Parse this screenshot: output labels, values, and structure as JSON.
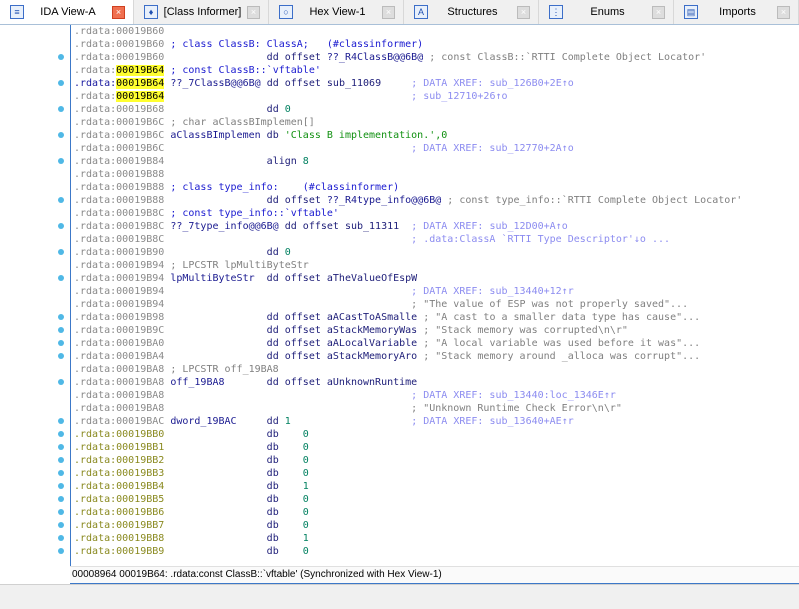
{
  "tabs": [
    {
      "label": "IDA View-A",
      "icon": "ida-view-icon",
      "active": true
    },
    {
      "label": "[Class Informer]",
      "icon": "class-informer-icon",
      "active": false
    },
    {
      "label": "Hex View-1",
      "icon": "hex-view-icon",
      "active": false
    },
    {
      "label": "Structures",
      "icon": "structures-icon",
      "active": false
    },
    {
      "label": "Enums",
      "icon": "enums-icon",
      "active": false
    },
    {
      "label": "Imports",
      "icon": "imports-icon",
      "active": false
    }
  ],
  "listing": [
    [
      [
        "a",
        ".rdata:00019B60"
      ]
    ],
    [
      [
        "a",
        ".rdata:00019B60"
      ],
      [
        "bl",
        " ; class ClassB: ClassA;   (#classinformer)"
      ]
    ],
    [
      [
        "a",
        ".rdata:00019B60"
      ],
      [
        "p",
        "                 "
      ],
      [
        "m",
        "dd offset "
      ],
      [
        "l",
        "??_R4ClassB@@6B@"
      ],
      [
        "cm",
        " ; const ClassB::`RTTI Complete Object Locator'"
      ]
    ],
    [
      [
        "a",
        ".rdata:"
      ],
      [
        "h",
        "00019B64"
      ],
      [
        "bl",
        " ; const ClassB::`vftable'"
      ]
    ],
    [
      [
        "ab",
        ".rdata:"
      ],
      [
        "h",
        "00019B64"
      ],
      [
        "l",
        " ??_7ClassB@@6B@ "
      ],
      [
        "m",
        "dd offset "
      ],
      [
        "o",
        "sub_11069"
      ],
      [
        "p",
        "     "
      ],
      [
        "x",
        "; DATA XREF: sub_126B0+2E↑o"
      ]
    ],
    [
      [
        "a",
        ".rdata:"
      ],
      [
        "h",
        "00019B64"
      ],
      [
        "p",
        "                                         "
      ],
      [
        "x",
        "; sub_12710+26↑o"
      ]
    ],
    [
      [
        "a",
        ".rdata:00019B68"
      ],
      [
        "p",
        "                 "
      ],
      [
        "m",
        "dd "
      ],
      [
        "n",
        "0"
      ]
    ],
    [
      [
        "a",
        ".rdata:00019B6C"
      ],
      [
        "cm",
        " ; char aClassBImplemen[]"
      ]
    ],
    [
      [
        "a",
        ".rdata:00019B6C"
      ],
      [
        "l",
        " aClassBImplemen "
      ],
      [
        "m",
        "db "
      ],
      [
        "s",
        "'Class B implementation.',0"
      ]
    ],
    [
      [
        "a",
        ".rdata:00019B6C"
      ],
      [
        "p",
        "                                         "
      ],
      [
        "x",
        "; DATA XREF: sub_12770+2A↑o"
      ]
    ],
    [
      [
        "a",
        ".rdata:00019B84"
      ],
      [
        "p",
        "                 "
      ],
      [
        "m",
        "align "
      ],
      [
        "n",
        "8"
      ]
    ],
    [
      [
        "a",
        ".rdata:00019B88"
      ]
    ],
    [
      [
        "a",
        ".rdata:00019B88"
      ],
      [
        "bl",
        " ; class type_info:    (#classinformer)"
      ]
    ],
    [
      [
        "a",
        ".rdata:00019B88"
      ],
      [
        "p",
        "                 "
      ],
      [
        "m",
        "dd offset "
      ],
      [
        "l",
        "??_R4type_info@@6B@"
      ],
      [
        "cm",
        " ; const type_info::`RTTI Complete Object Locator'"
      ]
    ],
    [
      [
        "a",
        ".rdata:00019B8C"
      ],
      [
        "bl",
        " ; const type_info::`vftable'"
      ]
    ],
    [
      [
        "a",
        ".rdata:00019B8C"
      ],
      [
        "l",
        " ??_7type_info@@6B@ "
      ],
      [
        "m",
        "dd offset "
      ],
      [
        "o",
        "sub_11311"
      ],
      [
        "p",
        "  "
      ],
      [
        "x",
        "; DATA XREF: sub_12D00+A↑o"
      ]
    ],
    [
      [
        "a",
        ".rdata:00019B8C"
      ],
      [
        "p",
        "                                         "
      ],
      [
        "x",
        "; .data:ClassA `RTTI Type Descriptor'↓o ..."
      ]
    ],
    [
      [
        "a",
        ".rdata:00019B90"
      ],
      [
        "p",
        "                 "
      ],
      [
        "m",
        "dd "
      ],
      [
        "n",
        "0"
      ]
    ],
    [
      [
        "a",
        ".rdata:00019B94"
      ],
      [
        "cm",
        " ; LPCSTR lpMultiByteStr"
      ]
    ],
    [
      [
        "a",
        ".rdata:00019B94"
      ],
      [
        "l",
        " lpMultiByteStr  "
      ],
      [
        "m",
        "dd offset "
      ],
      [
        "o",
        "aTheValueOfEspW"
      ]
    ],
    [
      [
        "a",
        ".rdata:00019B94"
      ],
      [
        "p",
        "                                         "
      ],
      [
        "x",
        "; DATA XREF: sub_13440+12↑r"
      ]
    ],
    [
      [
        "a",
        ".rdata:00019B94"
      ],
      [
        "p",
        "                                         "
      ],
      [
        "cm",
        "; \"The value of ESP was not properly saved\"..."
      ]
    ],
    [
      [
        "a",
        ".rdata:00019B98"
      ],
      [
        "p",
        "                 "
      ],
      [
        "m",
        "dd offset "
      ],
      [
        "o",
        "aACastToASmalle"
      ],
      [
        "cm",
        " ; \"A cast to a smaller data type has cause\"..."
      ]
    ],
    [
      [
        "a",
        ".rdata:00019B9C"
      ],
      [
        "p",
        "                 "
      ],
      [
        "m",
        "dd offset "
      ],
      [
        "o",
        "aStackMemoryWas"
      ],
      [
        "cm",
        " ; \"Stack memory was corrupted\\n\\r\""
      ]
    ],
    [
      [
        "a",
        ".rdata:00019BA0"
      ],
      [
        "p",
        "                 "
      ],
      [
        "m",
        "dd offset "
      ],
      [
        "o",
        "aALocalVariable"
      ],
      [
        "cm",
        " ; \"A local variable was used before it was\"..."
      ]
    ],
    [
      [
        "a",
        ".rdata:00019BA4"
      ],
      [
        "p",
        "                 "
      ],
      [
        "m",
        "dd offset "
      ],
      [
        "o",
        "aStackMemoryAro"
      ],
      [
        "cm",
        " ; \"Stack memory around _alloca was corrupt\"..."
      ]
    ],
    [
      [
        "a",
        ".rdata:00019BA8"
      ],
      [
        "cm",
        " ; LPCSTR off_19BA8"
      ]
    ],
    [
      [
        "a",
        ".rdata:00019BA8"
      ],
      [
        "l",
        " off_19BA8       "
      ],
      [
        "m",
        "dd offset "
      ],
      [
        "o",
        "aUnknownRuntime"
      ]
    ],
    [
      [
        "a",
        ".rdata:00019BA8"
      ],
      [
        "p",
        "                                         "
      ],
      [
        "x",
        "; DATA XREF: sub_13440:loc_1346E↑r"
      ]
    ],
    [
      [
        "a",
        ".rdata:00019BA8"
      ],
      [
        "p",
        "                                         "
      ],
      [
        "cm",
        "; \"Unknown Runtime Check Error\\n\\r\""
      ]
    ],
    [
      [
        "a",
        ".rdata:00019BAC"
      ],
      [
        "l",
        " dword_19BAC     "
      ],
      [
        "m",
        "dd "
      ],
      [
        "n",
        "1"
      ],
      [
        "p",
        "                    "
      ],
      [
        "x",
        "; DATA XREF: sub_13640+AE↑r"
      ]
    ],
    [
      [
        "ay",
        ".rdata:00019BB0"
      ],
      [
        "p",
        "                 "
      ],
      [
        "m",
        "db    "
      ],
      [
        "n",
        "0"
      ]
    ],
    [
      [
        "ay",
        ".rdata:00019BB1"
      ],
      [
        "p",
        "                 "
      ],
      [
        "m",
        "db    "
      ],
      [
        "n",
        "0"
      ]
    ],
    [
      [
        "ay",
        ".rdata:00019BB2"
      ],
      [
        "p",
        "                 "
      ],
      [
        "m",
        "db    "
      ],
      [
        "n",
        "0"
      ]
    ],
    [
      [
        "ay",
        ".rdata:00019BB3"
      ],
      [
        "p",
        "                 "
      ],
      [
        "m",
        "db    "
      ],
      [
        "n",
        "0"
      ]
    ],
    [
      [
        "ay",
        ".rdata:00019BB4"
      ],
      [
        "p",
        "                 "
      ],
      [
        "m",
        "db    "
      ],
      [
        "n",
        "1"
      ]
    ],
    [
      [
        "ay",
        ".rdata:00019BB5"
      ],
      [
        "p",
        "                 "
      ],
      [
        "m",
        "db    "
      ],
      [
        "n",
        "0"
      ]
    ],
    [
      [
        "ay",
        ".rdata:00019BB6"
      ],
      [
        "p",
        "                 "
      ],
      [
        "m",
        "db    "
      ],
      [
        "n",
        "0"
      ]
    ],
    [
      [
        "ay",
        ".rdata:00019BB7"
      ],
      [
        "p",
        "                 "
      ],
      [
        "m",
        "db    "
      ],
      [
        "n",
        "0"
      ]
    ],
    [
      [
        "ay",
        ".rdata:00019BB8"
      ],
      [
        "p",
        "                 "
      ],
      [
        "m",
        "db    "
      ],
      [
        "n",
        "1"
      ]
    ],
    [
      [
        "ay",
        ".rdata:00019BB9"
      ],
      [
        "p",
        "                 "
      ],
      [
        "m",
        "db    "
      ],
      [
        "n",
        "0"
      ]
    ]
  ],
  "gutter_dots": [
    2,
    4,
    6,
    8,
    10,
    13,
    15,
    17,
    19,
    22,
    23,
    24,
    25,
    27,
    30,
    31,
    32,
    33,
    34,
    35,
    36,
    37,
    38,
    39,
    40
  ],
  "status": "00008964 00019B64: .rdata:const ClassB::`vftable' (Synchronized with Hex View-1)"
}
